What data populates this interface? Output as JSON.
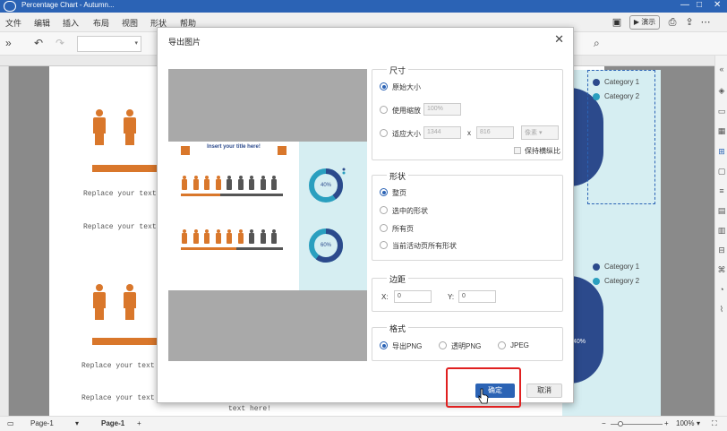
{
  "app": {
    "title": "Percentage Chart - Autumn...",
    "window_controls": [
      "—",
      "□",
      "✕"
    ]
  },
  "menu": {
    "items": [
      "文件",
      "编辑",
      "插入",
      "布局",
      "视图",
      "形状",
      "帮助"
    ],
    "present_label": "演示"
  },
  "canvas": {
    "replace_text": "Replace your text here",
    "text_here": "text here!",
    "legend_top": [
      "Category 1",
      "Category 2"
    ],
    "legend_bottom": [
      "Category 1",
      "Category 2"
    ],
    "partial_label": "40%",
    "colors": {
      "orange": "#d9772b",
      "navy": "#2c4a8c",
      "teal": "#2a9fbf",
      "panel": "#d6eef2"
    }
  },
  "dialog": {
    "title": "导出图片",
    "preview": {
      "heading": "Insert your title here!",
      "donut1": "40%",
      "donut2": "60%"
    },
    "size": {
      "legend": "尺寸",
      "original": "原始大小",
      "use_zoom": "使用缩放",
      "zoom_value": "100%",
      "fit_size": "适应大小",
      "width": "1344",
      "x": "x",
      "height": "816",
      "unit": "像素",
      "keep_ratio": "保持横纵比"
    },
    "shape": {
      "legend": "形状",
      "options": [
        "整页",
        "选中的形状",
        "所有页",
        "当前活动页所有形状"
      ],
      "selected": 0
    },
    "margin": {
      "legend": "边距",
      "x_label": "X:",
      "x_value": "0",
      "y_label": "Y:",
      "y_value": "0"
    },
    "format": {
      "legend": "格式",
      "options": [
        "导出PNG",
        "透明PNG",
        "JPEG"
      ],
      "selected": 0
    },
    "ok_label": "确定",
    "cancel_label": "取消"
  },
  "status": {
    "page_select": "Page-1",
    "active_tab": "Page-1",
    "add": "+",
    "zoom": "100%"
  }
}
